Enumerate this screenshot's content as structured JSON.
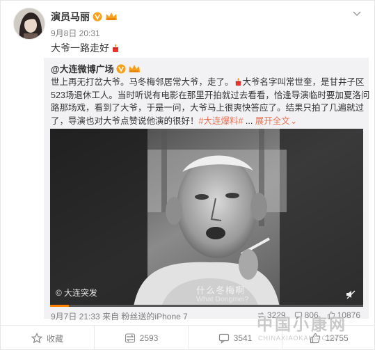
{
  "post": {
    "author_name": "演员马丽",
    "timestamp": "9月8日 20:31",
    "text": "大爷一路走好"
  },
  "repost": {
    "author_name": "@大连微博广场",
    "body_lines": [
      "世上再无打岔大爷。马冬梅邻居常大爷，走了。",
      "大爷名字叫常世奎，是甘井子区",
      "523场退休工人。当时听说有电影在那里开拍就过去看看，恰逢导演临时要加夏洛问",
      "路那场戏，看到了大爷，于是一问，大爷马上很爽快答应了。结果只拍了几遍就过",
      "了，导演也对大爷点赞说他演的很好！",
      "#大连爆料#",
      " ... ",
      "展开全文",
      "⌄"
    ],
    "video": {
      "source_label": "大连突发",
      "subtitle_zh": "什么冬梅啊",
      "subtitle_en": "What Dongmei?",
      "progress": 0.06
    },
    "meta": {
      "date": "9月7日 21:33",
      "from_label": "来自",
      "client": "粉丝送的iPhone 7"
    },
    "stats": {
      "reposts": "3229",
      "comments": "806",
      "likes": "10876"
    }
  },
  "actions": {
    "favorite_label": "收藏",
    "repost_count": "2593",
    "comment_count": "3541",
    "like_count": "12755"
  },
  "watermark": {
    "cn": "中国小康网",
    "en": "CHINAXIAOKANG.COM"
  },
  "colors": {
    "accent": "#eb7350",
    "verified": "#f7a11a",
    "gray_text": "#808080",
    "repost_bg": "#f2f2f5"
  },
  "icons": [
    "chevron-down-icon",
    "verified-icon",
    "crown-icon",
    "candle-emoji-icon",
    "repost-icon",
    "comment-icon",
    "like-icon",
    "favorite-icon",
    "mute-icon"
  ]
}
